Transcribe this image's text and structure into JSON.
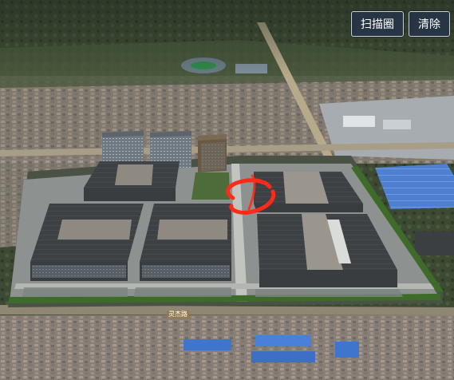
{
  "toolbar": {
    "scan_label": "扫描圈",
    "clear_label": "清除"
  },
  "map": {
    "road_label": "灵杰路",
    "scan_ring_color": "#ff2a1a"
  }
}
